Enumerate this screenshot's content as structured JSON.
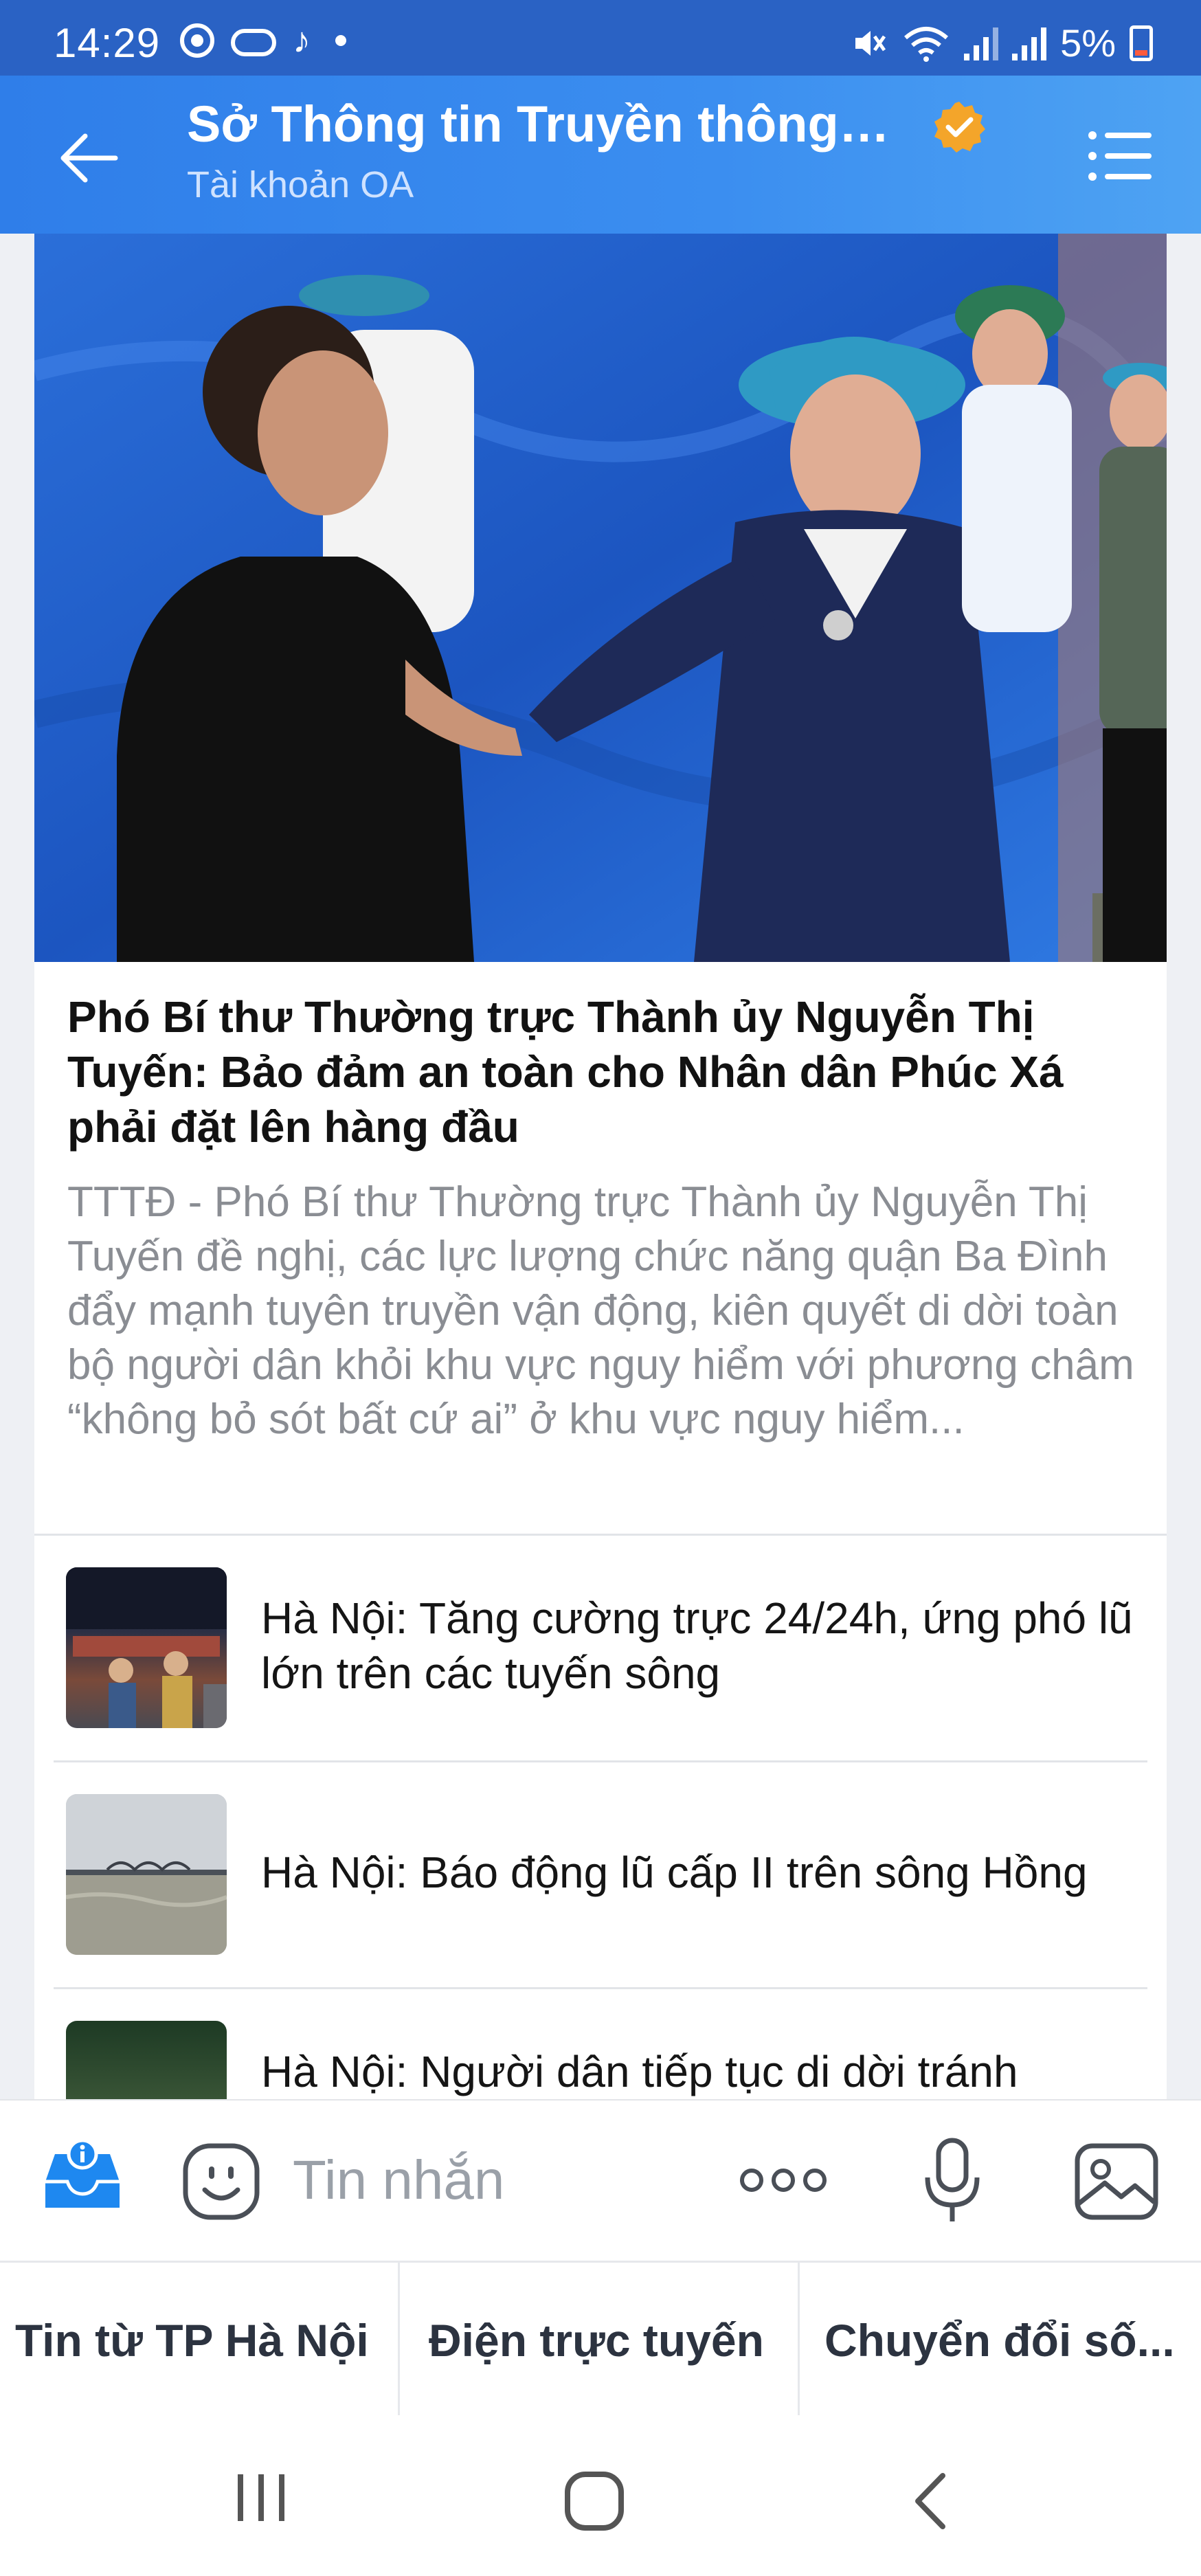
{
  "status_bar": {
    "time": "14:29",
    "battery": "5%",
    "icons": [
      "messenger-icon",
      "cloud-icon",
      "tiktok-icon",
      "dot-icon",
      "mute-icon",
      "wifi-icon",
      "signal-icon",
      "signal-icon",
      "battery-icon"
    ]
  },
  "header": {
    "title": "Sở Thông tin Truyền thông T...",
    "subtitle": "Tài khoản OA",
    "back_icon": "arrow-left-icon",
    "verified_icon": "verified-badge-icon",
    "menu_icon": "list-menu-icon",
    "accent_color": "#2f7ee9"
  },
  "featured": {
    "image_desc": "",
    "headline": "Phó Bí thư Thường trực Thành ủy Nguyễn Thị Tuyến: Bảo đảm an toàn cho Nhân dân Phúc Xá phải đặt lên hàng đầu",
    "summary": "TTTĐ - Phó Bí thư Thường trực Thành ủy Nguyễn Thị Tuyến đề nghị, các lực lượng chức năng quận Ba Đình đẩy mạnh tuyên truyền vận động, kiên quyết di dời toàn bộ người dân khỏi khu vực nguy hiểm với phương châm “không bỏ sót bất cứ ai” ở khu vực nguy hiểm..."
  },
  "news": [
    {
      "title": "Hà Nội: Tăng cường trực 24/24h, ứng phó lũ lớn trên các tuyến sông"
    },
    {
      "title": "Hà Nội: Báo động lũ cấp II trên sông Hồng"
    },
    {
      "title": "Hà Nội: Người dân tiếp tục di dời tránh"
    }
  ],
  "input_bar": {
    "placeholder": "Tin nhắn",
    "icons": [
      "inbox-info-icon",
      "emoji-icon",
      "more-icon",
      "microphone-icon",
      "image-icon"
    ]
  },
  "bottom_menu": [
    {
      "label": "Tin từ TP Hà Nội"
    },
    {
      "label": "Điện trực tuyến"
    },
    {
      "label": "Chuyển đổi số..."
    }
  ],
  "system_nav": [
    "recent-apps-icon",
    "home-icon",
    "back-icon"
  ]
}
